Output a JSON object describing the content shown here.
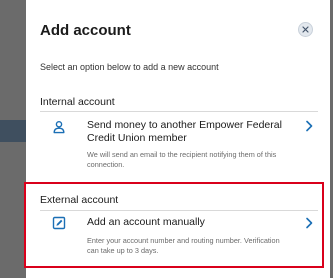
{
  "modal": {
    "title": "Add account",
    "close_icon": "close-icon",
    "subtitle": "Select an option below to add a new account"
  },
  "internal": {
    "heading": "Internal account",
    "option": {
      "icon": "person-icon",
      "title": "Send money to another Empower Federal Credit Union member",
      "description": "We will send an email to the recipient notifying them of this connection.",
      "chevron": "chevron-right-icon"
    }
  },
  "external": {
    "heading": "External account",
    "option": {
      "icon": "edit-icon",
      "title": "Add an account manually",
      "description": "Enter your account number and routing number. Verification can take up to 3 days.",
      "chevron": "chevron-right-icon"
    }
  },
  "colors": {
    "accent": "#1b6fb5",
    "highlight": "#d9001b",
    "backdrop": "#6b6b6b"
  }
}
